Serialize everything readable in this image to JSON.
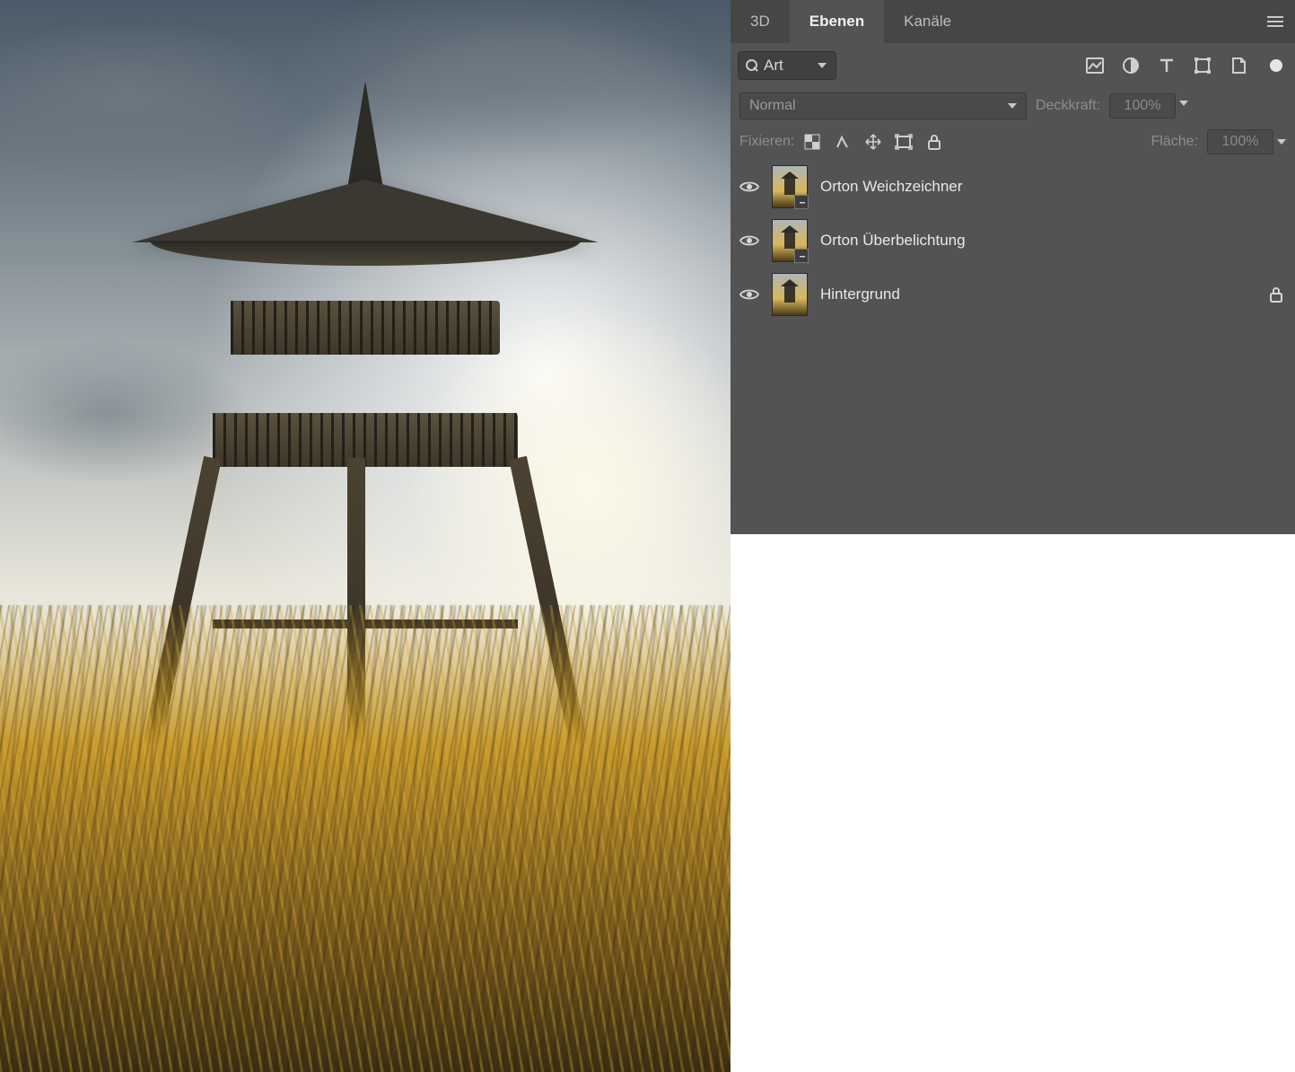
{
  "tabs": {
    "threeD": "3D",
    "layers": "Ebenen",
    "channels": "Kanäle",
    "active": "layers"
  },
  "filter": {
    "search_label": "Art"
  },
  "blend": {
    "mode": "Normal",
    "opacity_label": "Deckkraft:",
    "opacity_value": "100%"
  },
  "lock": {
    "label": "Fixieren:",
    "fill_label": "Fläche:",
    "fill_value": "100%"
  },
  "layers": [
    {
      "name": "Orton Weichzeichner",
      "smart": true,
      "locked": false
    },
    {
      "name": "Orton Überbelichtung",
      "smart": true,
      "locked": false
    },
    {
      "name": "Hintergrund",
      "smart": false,
      "locked": true
    }
  ]
}
